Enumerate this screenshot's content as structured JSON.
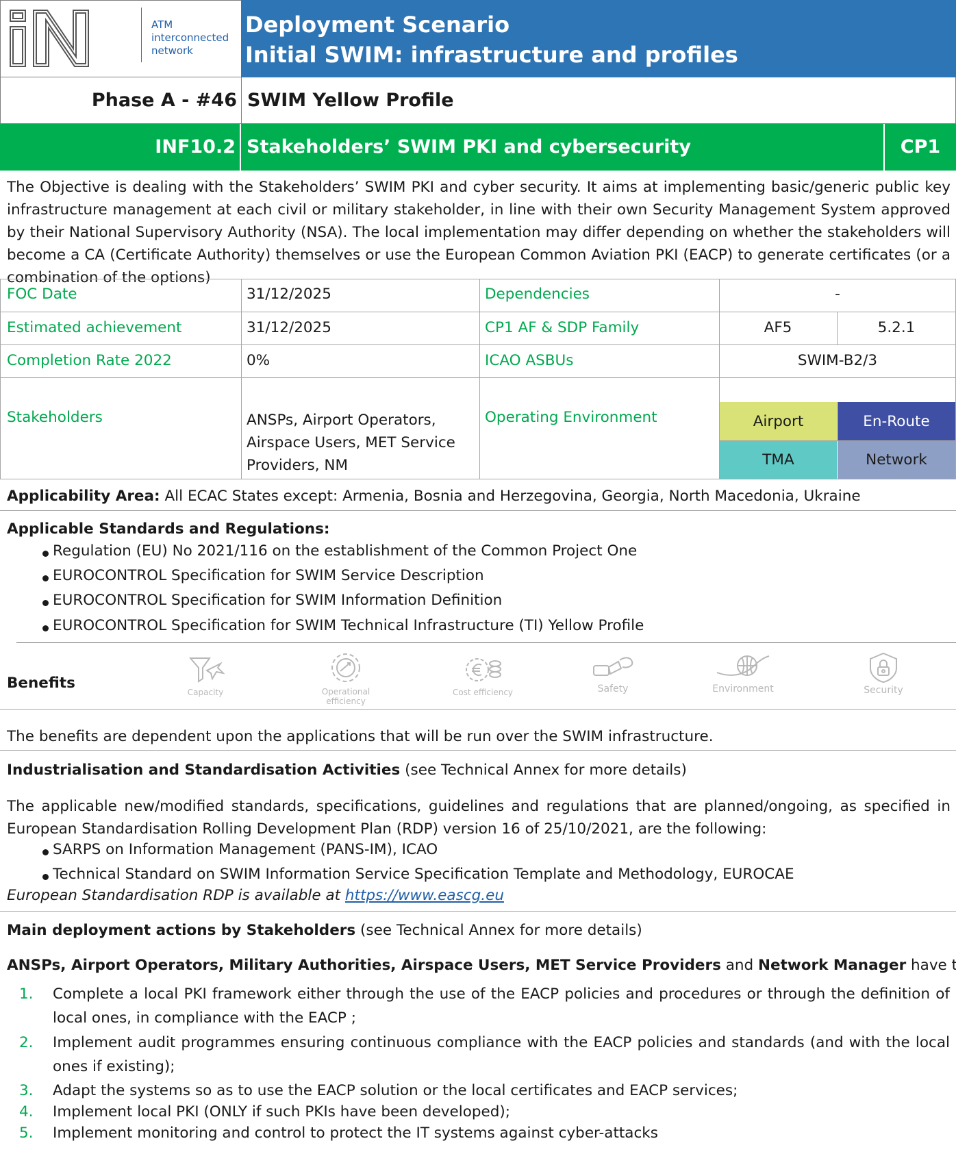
{
  "header": {
    "logo_letters": "iN",
    "logo_lines": [
      "ATM",
      "interconnected",
      "network"
    ],
    "title_line1": "Deployment Scenario",
    "title_line2": "Initial SWIM: infrastructure and profiles"
  },
  "phase": {
    "label": "Phase A - #46",
    "title": "SWIM Yellow Profile"
  },
  "objective": {
    "code": "INF10.2",
    "title": "Stakeholders’ SWIM PKI and cybersecurity",
    "project": "CP1"
  },
  "description": "The Objective is dealing with the Stakeholders’ SWIM PKI and cyber security. It aims at implementing basic/generic public key infrastructure management at each civil or military stakeholder, in line with their own Security Management System approved by their National Supervisory Authority (NSA). The local implementation may differ depending on whether the stakeholders will become a CA (Certificate Authority) themselves or use the European Common Aviation PKI (EACP) to generate certificates (or a combination of the options)",
  "info": {
    "foc_label": "FOC Date",
    "foc_value": "31/12/2025",
    "dependencies_label": "Dependencies",
    "dependencies_value": "-",
    "estimated_label": "Estimated achievement",
    "estimated_value": "31/12/2025",
    "family_label": "CP1 AF & SDP Family",
    "af_value": "AF5",
    "sdp_value": "5.2.1",
    "completion_label": "Completion Rate 2022",
    "completion_value": "0%",
    "asbu_label": "ICAO ASBUs",
    "asbu_value": "SWIM-B2/3",
    "stakeholders_label": "Stakeholders",
    "stakeholders_lines": [
      "ANSPs, Airport Operators,",
      "Airspace Users, MET Service",
      "Providers, NM"
    ],
    "env_label": "Operating Environment",
    "env": [
      "Airport",
      "En-Route",
      "TMA",
      "Network"
    ],
    "env_colors": {
      "airport": "#d9e276",
      "enroute": "#3f4fa3",
      "tma": "#5fc9c6",
      "network": "#8d9fc4"
    }
  },
  "applicability": {
    "label": "Applicability Area:",
    "text": " All ECAC States except: Armenia, Bosnia and Herzegovina, Georgia, North Macedonia, Ukraine"
  },
  "standards": {
    "heading": "Applicable Standards and Regulations:",
    "items": [
      "Regulation (EU) No 2021/116 on the establishment of the Common Project One",
      "EUROCONTROL Specification for SWIM Service Description",
      "EUROCONTROL Specification for SWIM Information Definition",
      "EUROCONTROL Specification for SWIM Technical Infrastructure (TI) Yellow Profile"
    ]
  },
  "benefits": {
    "label": "Benefits",
    "icons": [
      "Capacity",
      "Operational",
      "efficiency",
      "Cost efficiency",
      "Safety",
      "Environment",
      "Security"
    ],
    "note": "The benefits are dependent upon the applications that will be run over the SWIM infrastructure."
  },
  "industrialisation": {
    "heading": "Industrialisation and Standardisation Activities",
    "heading_suffix": " (see Technical Annex for more details)",
    "intro": "The applicable new/modified standards, specifications, guidelines and regulations that are planned/ongoing, as specified in European Standardisation Rolling Development Plan (RDP) version 16 of 25/10/2021, are the following:",
    "items": [
      "SARPS on Information Management (PANS-IM), ICAO",
      "Technical Standard on SWIM Information Service Specification Template and Methodology, EUROCAE"
    ],
    "rdp_prefix": "European Standardisation RDP is available at ",
    "rdp_link": "https://www.eascg.eu"
  },
  "actions": {
    "heading": "Main deployment actions by Stakeholders",
    "heading_suffix": " (see Technical Annex for more details)",
    "who_bold": "ANSPs, Airport Operators, Military Authorities, Airspace Users, MET Service Providers",
    "who_and": " and ",
    "who_bold2": "Network Manager",
    "who_suffix": " have to:",
    "items": [
      {
        "num": "1.",
        "text": "Complete a local PKI framework either through the use of the EACP policies and procedures or through the definition of local ones, in compliance with the EACP ;"
      },
      {
        "num": "2.",
        "text": "Implement audit programmes ensuring continuous compliance with the EACP policies and standards (and with the local ones if existing);"
      },
      {
        "num": "3.",
        "text": "Adapt the systems so as to use the EACP solution or the local certificates and EACP services;"
      },
      {
        "num": "4.",
        "text": "Implement local PKI (ONLY if such PKIs have been developed);"
      },
      {
        "num": "5.",
        "text": "Implement monitoring and control to protect the IT systems against cyber-attacks"
      }
    ]
  }
}
